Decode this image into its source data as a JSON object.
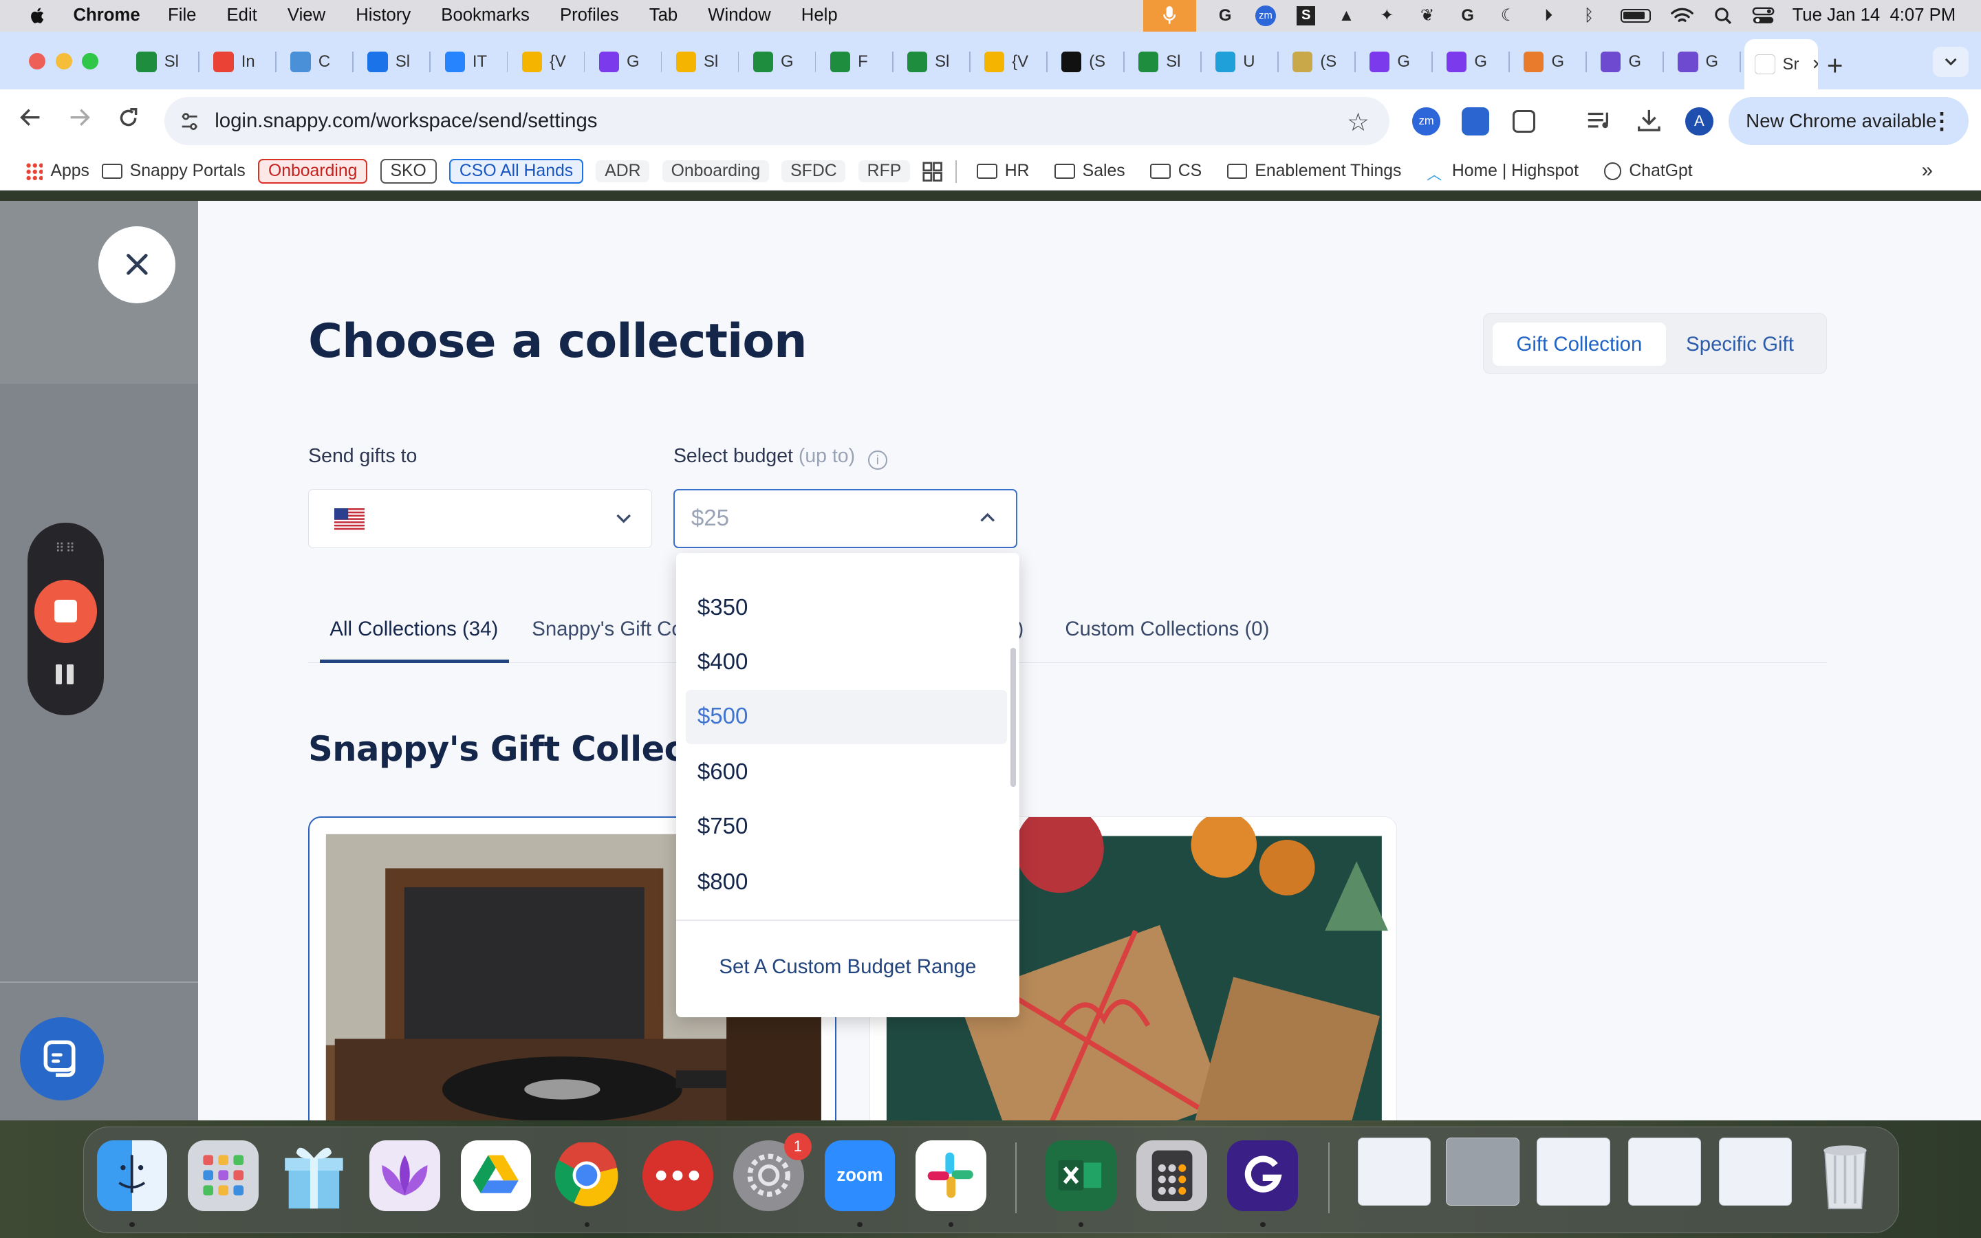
{
  "menubar": {
    "app": "Chrome",
    "items": [
      "File",
      "Edit",
      "View",
      "History",
      "Bookmarks",
      "Profiles",
      "Tab",
      "Window",
      "Help"
    ],
    "clock": "Tue Jan 14  4:07 PM"
  },
  "tabs": [
    {
      "label": "Sl",
      "icon": "sheets-icon",
      "color": "#1e8e3e"
    },
    {
      "label": "In",
      "icon": "gmail-icon",
      "color": "#ea4335"
    },
    {
      "label": "C",
      "icon": "box-icon",
      "color": "#4a90d9"
    },
    {
      "label": "Sl",
      "icon": "calendar-icon",
      "color": "#1a73e8"
    },
    {
      "label": "IT",
      "icon": "jira-icon",
      "color": "#2684ff"
    },
    {
      "label": "{V",
      "icon": "slides-icon",
      "color": "#f4b400"
    },
    {
      "label": "G",
      "icon": "app-icon",
      "color": "#7c3aed"
    },
    {
      "label": "Sl",
      "icon": "slides-icon",
      "color": "#f4b400"
    },
    {
      "label": "G",
      "icon": "sheets-icon",
      "color": "#1e8e3e"
    },
    {
      "label": "F",
      "icon": "sheets-icon",
      "color": "#1e8e3e"
    },
    {
      "label": "Sl",
      "icon": "sheets-icon",
      "color": "#1e8e3e"
    },
    {
      "label": "{V",
      "icon": "slides-icon",
      "color": "#f4b400"
    },
    {
      "label": "(S",
      "icon": "notion-icon",
      "color": "#111111"
    },
    {
      "label": "Sl",
      "icon": "sheets-icon",
      "color": "#1e8e3e"
    },
    {
      "label": "U",
      "icon": "u-icon",
      "color": "#20a0d8"
    },
    {
      "label": "(S",
      "icon": "bill-icon",
      "color": "#c9a84a"
    },
    {
      "label": "G",
      "icon": "app-icon",
      "color": "#7c3aed"
    },
    {
      "label": "G",
      "icon": "app-icon",
      "color": "#7c3aed"
    },
    {
      "label": "G",
      "icon": "rainbow-icon",
      "color": "#e87b2c"
    },
    {
      "label": "G",
      "icon": "g-icon",
      "color": "#6d4ad0"
    },
    {
      "label": "G",
      "icon": "g-icon",
      "color": "#6d4ad0"
    },
    {
      "label": "Sr",
      "icon": "snappy-icon",
      "color": "#ffffff",
      "active": true
    }
  ],
  "toolbar": {
    "url": "login.snappy.com/workspace/send/settings",
    "update_label": "New Chrome available",
    "profile_initial": "A"
  },
  "bookmarks": {
    "apps": "Apps",
    "snappy_portals": "Snappy Portals",
    "onboarding_red": "Onboarding",
    "sko": "SKO",
    "cso": "CSO All Hands",
    "adr": "ADR",
    "onboarding_gray": "Onboarding",
    "sfdc": "SFDC",
    "rfp": "RFP",
    "hr": "HR",
    "sales": "Sales",
    "cs": "CS",
    "enablement": "Enablement Things",
    "highspot": "Home | Highspot",
    "chatgpt": "ChatGpt"
  },
  "page": {
    "title": "Choose a collection",
    "toggle": {
      "active": "Gift Collection",
      "inactive": "Specific Gift"
    },
    "send_to_label": "Send gifts to",
    "budget_label": "Select budget",
    "budget_hint": "(up to)",
    "budget_value": "$25",
    "collection_tabs": [
      "All Collections (34)",
      "Snappy's Gift Co",
      ")",
      "Custom Collections (0)"
    ],
    "section_title": "Snappy's Gift Collectio"
  },
  "dropdown": {
    "options": [
      "$350",
      "$400",
      "$500",
      "$600",
      "$750",
      "$800"
    ],
    "highlighted": "$500",
    "custom_label": "Set A Custom Budget Range"
  },
  "dock": {
    "system_settings_badge": "1",
    "zoom_label": "zoom"
  },
  "colors": {
    "brand_navy": "#15264b",
    "accent_blue": "#1f63c4",
    "recorder_stop": "#ef5a42"
  }
}
